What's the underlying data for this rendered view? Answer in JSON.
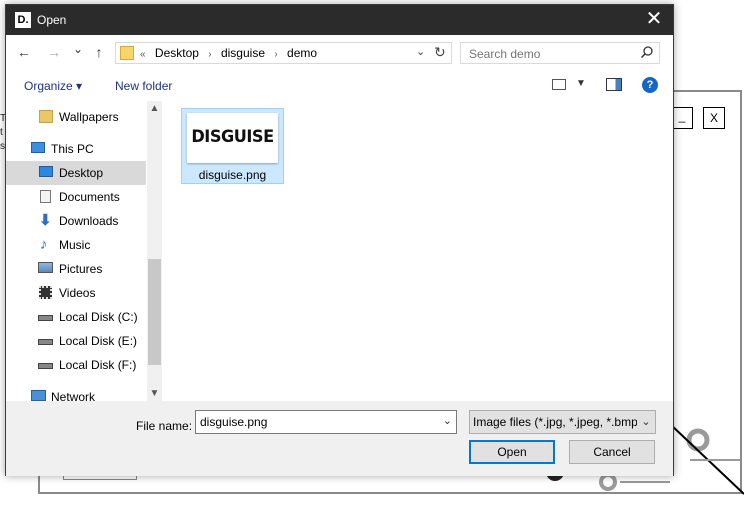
{
  "dialog": {
    "title": "Open",
    "app_icon_letter": "D.",
    "close_glyph": "✕"
  },
  "nav": {
    "back": "←",
    "forward": "→",
    "recent": "⌄",
    "up": "↑",
    "address": {
      "prefix": "«",
      "crumbs": [
        "Desktop",
        "disguise",
        "demo"
      ],
      "dropdown": "⌄",
      "refresh": "↻"
    },
    "search_placeholder": "Search demo",
    "search_icon": "⌕"
  },
  "toolbar": {
    "organize": "Organize ▾",
    "new_folder": "New folder",
    "view_dropdown": "▼",
    "help": "?"
  },
  "sidebar": {
    "items": [
      {
        "label": "Wallpapers",
        "icon": "folder-icon",
        "indent": 2
      },
      {
        "label": "This PC",
        "icon": "computer-icon",
        "indent": 1
      },
      {
        "label": "Desktop",
        "icon": "desktop-icon",
        "indent": 2,
        "selected": true
      },
      {
        "label": "Documents",
        "icon": "documents-icon",
        "indent": 2
      },
      {
        "label": "Downloads",
        "icon": "downloads-icon",
        "indent": 2
      },
      {
        "label": "Music",
        "icon": "music-icon",
        "indent": 2
      },
      {
        "label": "Pictures",
        "icon": "pictures-icon",
        "indent": 2
      },
      {
        "label": "Videos",
        "icon": "videos-icon",
        "indent": 2
      },
      {
        "label": "Local Disk (C:)",
        "icon": "drive-icon",
        "indent": 2
      },
      {
        "label": "Local Disk (E:)",
        "icon": "drive-icon",
        "indent": 2
      },
      {
        "label": "Local Disk (F:)",
        "icon": "drive-icon",
        "indent": 2
      },
      {
        "label": "Network",
        "icon": "network-icon",
        "indent": 1
      }
    ],
    "scroll_up": "▲",
    "scroll_down": "▼"
  },
  "files": [
    {
      "name": "disguise.png",
      "thumbnail_text": "DISGUISE",
      "selected": true
    }
  ],
  "footer": {
    "file_name_label": "File name:",
    "file_name_value": "disguise.png",
    "file_name_dropdown": "⌄",
    "filter": "Image files (*.jpg, *.jpeg, *.bmp",
    "filter_dropdown": "⌄",
    "open_button": "Open",
    "cancel_button": "Cancel"
  },
  "background_window": {
    "minimize": "_",
    "close": "X",
    "left_text": [
      "T",
      "t",
      "s"
    ]
  },
  "colors": {
    "titlebar": "#2b2b2b",
    "selection": "#cce8ff",
    "link_blue": "#1e3287",
    "accent": "#0078d7"
  }
}
